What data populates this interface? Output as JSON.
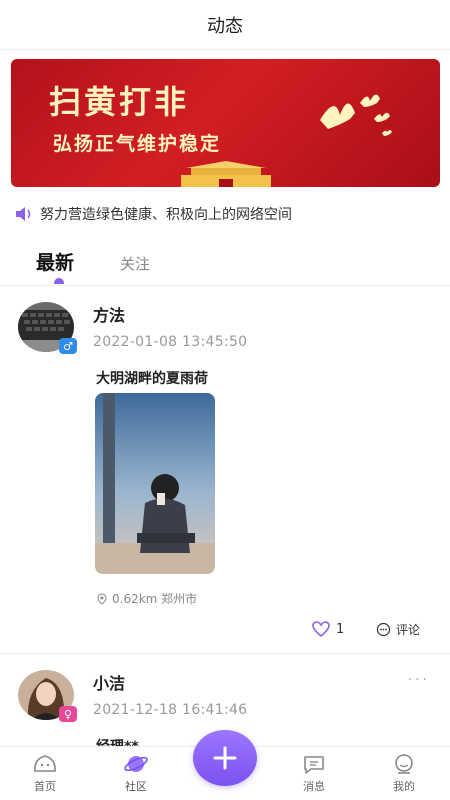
{
  "header": {
    "title": "动态"
  },
  "banner": {
    "line1": "扫黄打非",
    "line2": "弘扬正气维护稳定"
  },
  "notice": {
    "icon": "speaker-icon",
    "text": "努力营造绿色健康、积极向上的网络空间"
  },
  "tabs": {
    "latest": "最新",
    "follow": "关注",
    "active_color": "#8a63e8"
  },
  "posts": [
    {
      "username": "方法",
      "gender": "male",
      "time": "2022-01-08 13:45:50",
      "title": "大明湖畔的夏雨荷",
      "location": "0.62km 郑州市",
      "likes": "1",
      "comment_label": "评论"
    },
    {
      "username": "小洁",
      "gender": "female",
      "time": "2021-12-18 16:41:46",
      "title": "经理**",
      "more": "···"
    }
  ],
  "tabbar": {
    "home": "首页",
    "community": "社区",
    "messages": "消息",
    "mine": "我的",
    "fab": "+"
  },
  "colors": {
    "accent": "#8a63e8",
    "male": "#2f8ce8",
    "female": "#e8489a",
    "banner_red": "#c8161d"
  }
}
